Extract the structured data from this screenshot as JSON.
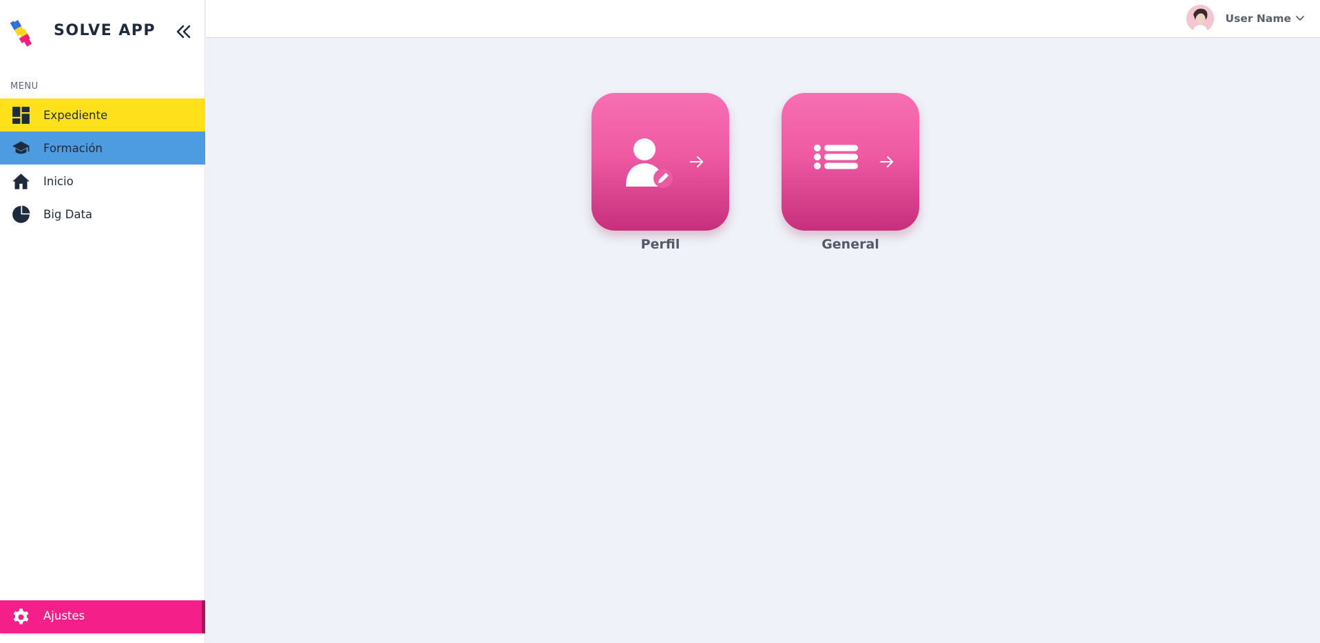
{
  "app": {
    "name": "SOLVE APP"
  },
  "sidebar": {
    "menu_label": "MENU",
    "items": [
      {
        "label": "Expediente",
        "icon": "dashboard-icon",
        "color": "#ffe11b"
      },
      {
        "label": "Formación",
        "icon": "graduation-cap-icon",
        "color": "#4d9be0"
      },
      {
        "label": "Inicio",
        "icon": "home-icon",
        "color": "#ffffff"
      },
      {
        "label": "Big Data",
        "icon": "pie-chart-icon",
        "color": "#ffffff"
      }
    ],
    "settings": {
      "label": "Ajustes",
      "icon": "gear-icon",
      "color": "#f51f8a"
    }
  },
  "header": {
    "user_name": "User Name"
  },
  "cards": [
    {
      "label": "Perfil",
      "icon": "user-edit-icon"
    },
    {
      "label": "General",
      "icon": "list-icon"
    }
  ],
  "colors": {
    "background": "#eff2f8",
    "card_gradient_top": "#f76fb3",
    "card_gradient_bottom": "#c72f7c"
  }
}
